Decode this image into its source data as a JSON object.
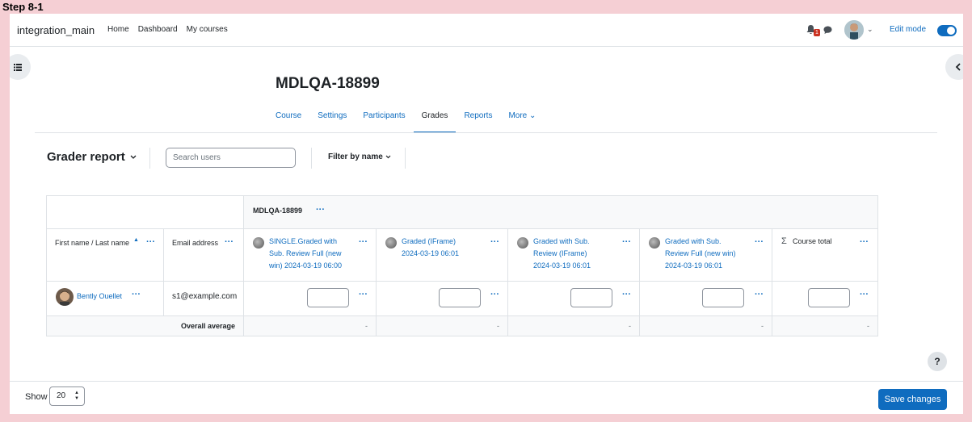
{
  "step_label": "Step 8-1",
  "navbar": {
    "brand": "integration_main",
    "links": [
      "Home",
      "Dashboard",
      "My courses"
    ],
    "notification_count": "1",
    "edit_mode_label": "Edit mode",
    "edit_mode_on": true
  },
  "course": {
    "title": "MDLQA-18899",
    "tabs": [
      {
        "label": "Course",
        "active": false
      },
      {
        "label": "Settings",
        "active": false
      },
      {
        "label": "Participants",
        "active": false
      },
      {
        "label": "Grades",
        "active": true
      },
      {
        "label": "Reports",
        "active": false
      },
      {
        "label": "More",
        "active": false
      }
    ]
  },
  "action_bar": {
    "report_title": "Grader report",
    "search_placeholder": "Search users",
    "filter_label": "Filter by name"
  },
  "grader": {
    "category_name": "MDLQA-18899",
    "col_name_header": "First name / Last name",
    "col_email_header": "Email address",
    "items": [
      {
        "name": "SINGLE.Graded with Sub. Review Full (new win) 2024-03-19 06:00"
      },
      {
        "name": "Graded (IFrame) 2024-03-19 06:01"
      },
      {
        "name": "Graded with Sub. Review (IFrame) 2024-03-19 06:01"
      },
      {
        "name": "Graded with Sub. Review Full (new win) 2024-03-19 06:01"
      }
    ],
    "course_total_label": "Course total",
    "students": [
      {
        "name": "Bently Ouellet",
        "email": "s1@example.com"
      }
    ],
    "overall_average_label": "Overall average",
    "averages": [
      "-",
      "-",
      "-",
      "-",
      "-"
    ]
  },
  "footer": {
    "show_label": "Show",
    "per_page": "20",
    "save_label": "Save changes"
  },
  "help_label": "?",
  "colors": {
    "accent": "#0f6cbf",
    "frame_bg": "#f5cfd4",
    "header_bg": "#f8f9fa"
  }
}
